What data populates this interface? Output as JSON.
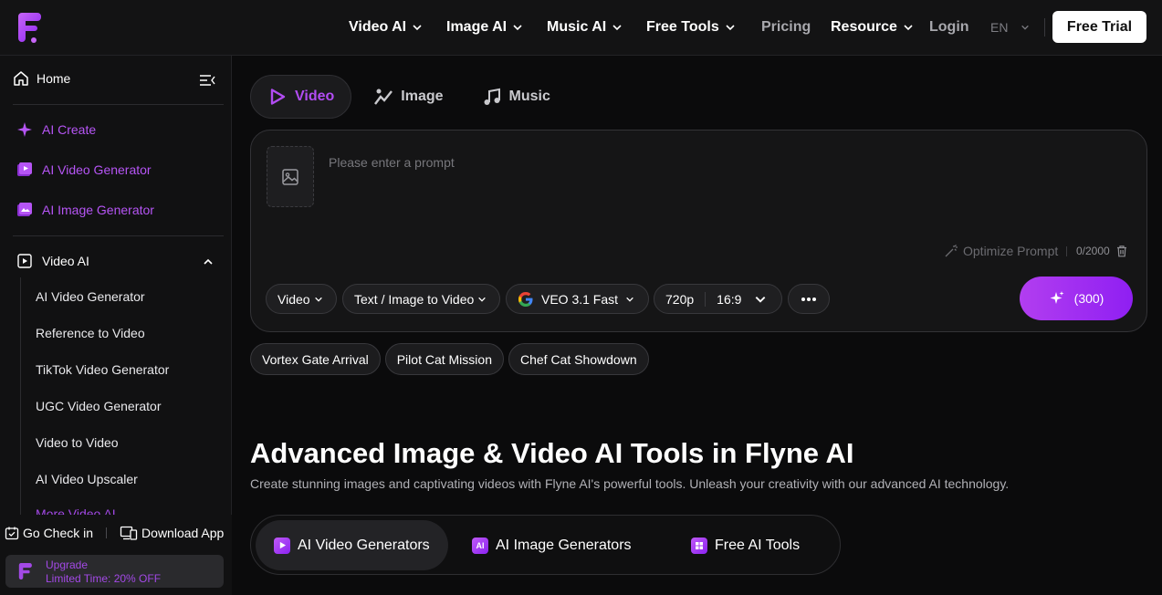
{
  "header": {
    "nav": [
      {
        "label": "Video AI",
        "dropdown": true
      },
      {
        "label": "Image AI",
        "dropdown": true
      },
      {
        "label": "Music AI",
        "dropdown": true
      },
      {
        "label": "Free Tools",
        "dropdown": true
      },
      {
        "label": "Pricing",
        "dropdown": false
      },
      {
        "label": "Resource",
        "dropdown": true
      }
    ],
    "login": "Login",
    "lang": "EN",
    "free_trial": "Free Trial"
  },
  "sidebar": {
    "home": "Home",
    "primary": [
      "AI Create",
      "AI Video Generator",
      "AI Image Generator"
    ],
    "section": "Video AI",
    "sub_items": [
      "AI Video Generator",
      "Reference to Video",
      "TikTok Video Generator",
      "UGC Video Generator",
      "Video to Video",
      "AI Video Upscaler",
      "More Video AI"
    ],
    "check_in": "Go Check in",
    "download": "Download App",
    "upgrade_title": "Upgrade",
    "upgrade_sub": "Limited Time: 20% OFF"
  },
  "main": {
    "tabs": [
      "Video",
      "Image",
      "Music"
    ],
    "prompt": {
      "placeholder": "Please enter a prompt",
      "optimize": "Optimize Prompt",
      "counter": "0/2000"
    },
    "options": {
      "type": "Video",
      "mode": "Text / Image to Video",
      "model": "VEO 3.1 Fast",
      "resolution": "720p",
      "ratio": "16:9"
    },
    "generate": "(300)",
    "chips": [
      "Vortex Gate Arrival",
      "Pilot Cat Mission",
      "Chef Cat Showdown"
    ],
    "hero_title": "Advanced Image & Video AI Tools in Flyne AI",
    "hero_sub": "Create stunning images and captivating videos with Flyne AI's powerful tools. Unleash your creativity with our advanced AI technology.",
    "categories": [
      "AI Video Generators",
      "AI Image Generators",
      "Free AI Tools"
    ]
  },
  "colors": {
    "accent": "#b24cf3",
    "background": "#0b0b0c",
    "panel": "#151516"
  }
}
